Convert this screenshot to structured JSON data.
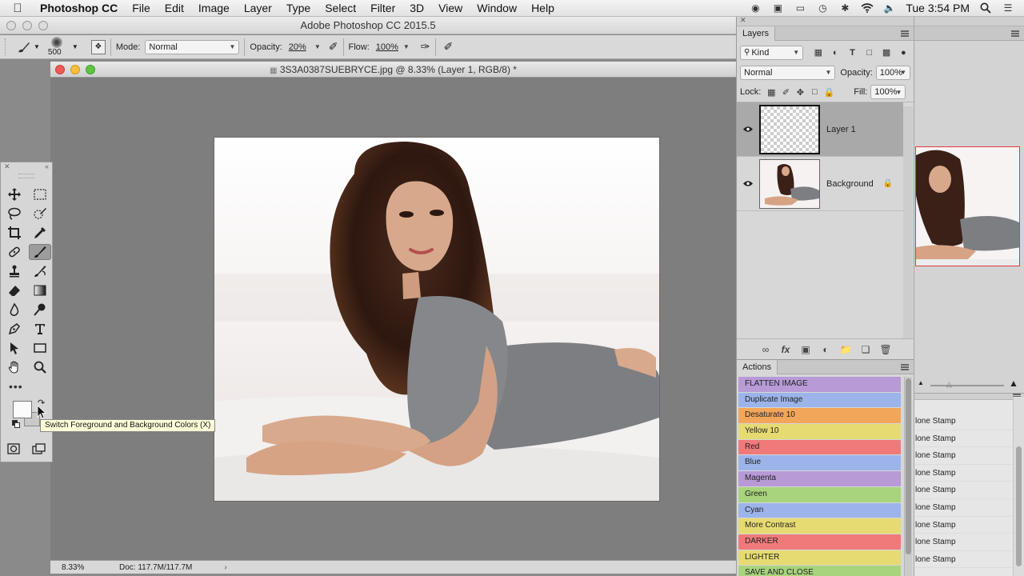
{
  "menubar": {
    "app": "Photoshop CC",
    "items": [
      "File",
      "Edit",
      "Image",
      "Layer",
      "Type",
      "Select",
      "Filter",
      "3D",
      "View",
      "Window",
      "Help"
    ],
    "clock": "Tue 3:54 PM"
  },
  "app_title": "Adobe Photoshop CC 2015.5",
  "options": {
    "brush_size": "500",
    "mode_label": "Mode:",
    "mode_value": "Normal",
    "opacity_label": "Opacity:",
    "opacity_value": "20%",
    "flow_label": "Flow:",
    "flow_value": "100%"
  },
  "document": {
    "title": "3S3A0387SUEBRYCE.jpg @ 8.33% (Layer 1, RGB/8) *",
    "zoom": "8.33%",
    "doc_size": "Doc: 117.7M/117.7M"
  },
  "tooltip": "Switch Foreground and Background Colors (X)",
  "layers_panel": {
    "tab": "Layers",
    "filter": "Kind",
    "blend_mode": "Normal",
    "opacity_label": "Opacity:",
    "opacity_value": "100%",
    "lock_label": "Lock:",
    "fill_label": "Fill:",
    "fill_value": "100%",
    "layers": [
      {
        "name": "Layer 1",
        "selected": true
      },
      {
        "name": "Background",
        "selected": false
      }
    ]
  },
  "actions_panel": {
    "tab": "Actions",
    "items": [
      {
        "label": "FLATTEN IMAGE",
        "color": "#b79ad6"
      },
      {
        "label": "Duplicate Image",
        "color": "#9cb4ea"
      },
      {
        "label": "Desaturate 10",
        "color": "#f2a65a"
      },
      {
        "label": "Yellow 10",
        "color": "#e6db72"
      },
      {
        "label": "Red",
        "color": "#f07a7a"
      },
      {
        "label": "Blue",
        "color": "#9cb4ea"
      },
      {
        "label": "Magenta",
        "color": "#b79ad6"
      },
      {
        "label": "Green",
        "color": "#a7d47c"
      },
      {
        "label": "Cyan",
        "color": "#9cb4ea"
      },
      {
        "label": "More Contrast",
        "color": "#e6db72"
      },
      {
        "label": "DARKER",
        "color": "#f07a7a"
      },
      {
        "label": "LIGHTER",
        "color": "#e6db72"
      },
      {
        "label": "SAVE AND CLOSE",
        "color": "#a7d47c"
      }
    ]
  },
  "history_panel": {
    "items": [
      "lone Stamp",
      "lone Stamp",
      "lone Stamp",
      "lone Stamp",
      "lone Stamp",
      "lone Stamp",
      "lone Stamp",
      "lone Stamp",
      "lone Stamp"
    ]
  }
}
